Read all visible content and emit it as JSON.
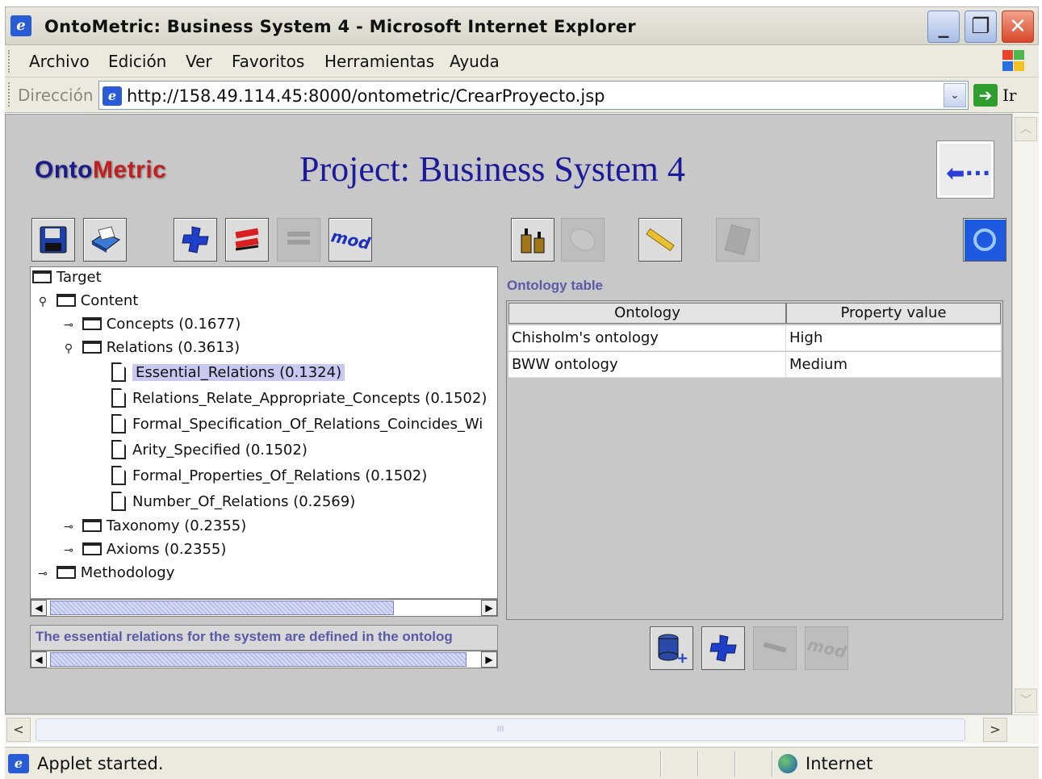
{
  "window": {
    "title": "OntoMetric: Business System 4 - Microsoft Internet Explorer",
    "app_icon": "ie-icon",
    "controls": [
      "minimize",
      "maximize",
      "close"
    ]
  },
  "menu": [
    "Archivo",
    "Edición",
    "Ver",
    "Favoritos",
    "Herramientas",
    "Ayuda"
  ],
  "address": {
    "label": "Dirección",
    "url": "http://158.49.114.45:8000/ontometric/CrearProyecto.jsp",
    "go_label": "Ir"
  },
  "applet": {
    "logo_part1": "Onto",
    "logo_part2": "Metric",
    "project_title": "Project: Business System 4",
    "left_toolbar": [
      "save-icon",
      "print-icon",
      "add-icon",
      "delete-icon",
      "edit-icon-disabled",
      "mod-icon"
    ],
    "mod_label": "mod",
    "right_toolbar": [
      "weights-icon",
      "disk-icon-disabled",
      "ruler-icon",
      "calculator-icon-disabled",
      "refresh-icon"
    ],
    "tree": [
      {
        "level": 0,
        "toggle": "",
        "kind": "folder",
        "label": "Target"
      },
      {
        "level": 0,
        "toggle": "⚲",
        "kind": "folder",
        "label": "Content"
      },
      {
        "level": 1,
        "toggle": "⊸",
        "kind": "folder",
        "label": "Concepts (0.1677)"
      },
      {
        "level": 1,
        "toggle": "⚲",
        "kind": "folder",
        "label": "Relations (0.3613)"
      },
      {
        "level": 2,
        "toggle": "",
        "kind": "doc",
        "label": "Essential_Relations (0.1324)",
        "selected": true
      },
      {
        "level": 2,
        "toggle": "",
        "kind": "doc",
        "label": "Relations_Relate_Appropriate_Concepts (0.1502)"
      },
      {
        "level": 2,
        "toggle": "",
        "kind": "doc",
        "label": "Formal_Specification_Of_Relations_Coincides_Wi"
      },
      {
        "level": 2,
        "toggle": "",
        "kind": "doc",
        "label": "Arity_Specified (0.1502)"
      },
      {
        "level": 2,
        "toggle": "",
        "kind": "doc",
        "label": "Formal_Properties_Of_Relations (0.1502)"
      },
      {
        "level": 2,
        "toggle": "",
        "kind": "doc",
        "label": "Number_Of_Relations (0.2569)"
      },
      {
        "level": 1,
        "toggle": "⊸",
        "kind": "folder",
        "label": "Taxonomy (0.2355)"
      },
      {
        "level": 1,
        "toggle": "⊸",
        "kind": "folder",
        "label": "Axioms (0.2355)"
      },
      {
        "level": 0,
        "toggle": "⊸",
        "kind": "folder",
        "label": "Methodology"
      }
    ],
    "description": "The essential relations for the system are defined in the ontolog",
    "table_label": "Ontology table",
    "table_headers": [
      "Ontology",
      "Property value"
    ],
    "table_rows": [
      [
        "Chisholm's ontology",
        "High"
      ],
      [
        "BWW ontology",
        "Medium"
      ]
    ],
    "bottom_toolbar": [
      "database-add-icon",
      "add-icon",
      "edit-icon-disabled",
      "mod-icon-disabled"
    ]
  },
  "status": {
    "text": "Applet started.",
    "zone": "Internet"
  }
}
